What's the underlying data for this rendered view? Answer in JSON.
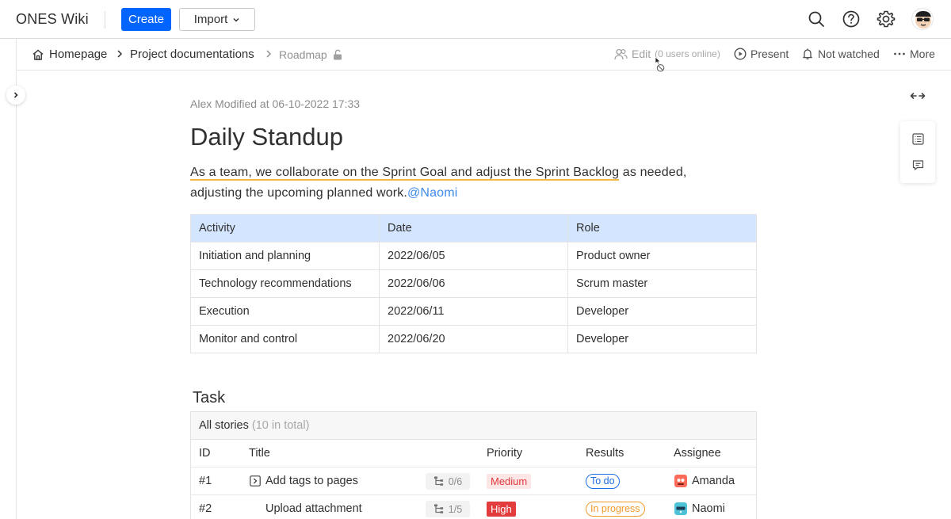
{
  "topbar": {
    "brand": "ONES Wiki",
    "create_label": "Create",
    "import_label": "Import",
    "icons": [
      "search-icon",
      "help-icon",
      "gear-icon",
      "avatar"
    ]
  },
  "breadcrumb": {
    "items": [
      "Homepage",
      "Project documentations"
    ],
    "current": "Roadmap"
  },
  "actions": {
    "edit_label": "Edit",
    "online_label": "(0 users online)",
    "present_label": "Present",
    "watch_label": "Not watched",
    "more_label": "More"
  },
  "document": {
    "meta": "Alex Modified at 06-10-2022 17:33",
    "title": "Daily Standup",
    "para_highlight": "As a team, we collaborate on the Sprint Goal and adjust the Sprint Backlog",
    "para_rest_1": " as needed,",
    "para_rest_2": "adjusting the upcoming planned work.",
    "mention": "@Naomi"
  },
  "activity_table": {
    "headers": [
      "Activity",
      "Date",
      "Role"
    ],
    "rows": [
      [
        "Initiation and planning",
        "2022/06/05",
        "Product owner"
      ],
      [
        "Technology recommendations",
        "2022/06/06",
        "Scrum master"
      ],
      [
        "Execution",
        "2022/06/11",
        "Developer"
      ],
      [
        "Monitor and control",
        "2022/06/20",
        "Developer"
      ]
    ]
  },
  "task": {
    "heading": "Task",
    "list_label": "All stories",
    "list_count": "(10 in total)",
    "columns": [
      "ID",
      "Title",
      "Priority",
      "Results",
      "Assignee"
    ],
    "rows": [
      {
        "id": "#1",
        "title": "Add tags to pages",
        "subtasks": "0/6",
        "priority": "Medium",
        "result": "To do",
        "assignee": "Amanda"
      },
      {
        "id": "#2",
        "title": "Upload attachment",
        "subtasks": "1/5",
        "priority": "High",
        "result": "In progress",
        "assignee": "Naomi"
      }
    ]
  },
  "colors": {
    "primary": "#0064ff",
    "table_header": "#d4e5ff",
    "highlight_underline": "#f5b94a",
    "mention": "#3d8be8",
    "priority_high": "#e23c3c",
    "result_todo": "#1a6ee8",
    "result_progress": "#f09a2a"
  }
}
